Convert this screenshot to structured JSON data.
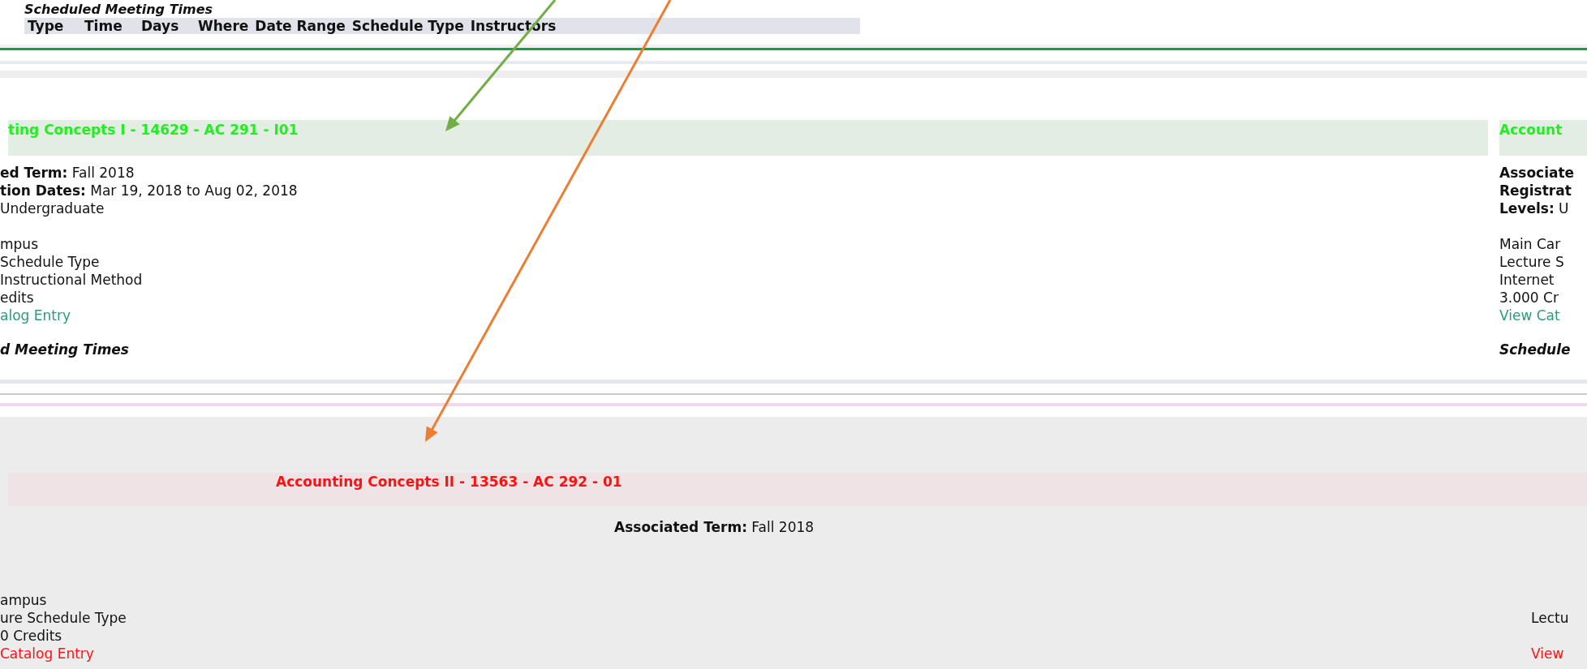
{
  "top_section": {
    "heading": "Scheduled Meeting Times",
    "columns": [
      "Type",
      "Time",
      "Days",
      "Where",
      "Date Range",
      "Schedule Type",
      "Instructors"
    ]
  },
  "upper_panels": [
    {
      "title": "ting Concepts I - 14629 - AC 291 - I01",
      "color": "#22ee22",
      "fields": [
        {
          "label": "ed Term:",
          "value": " Fall 2018"
        },
        {
          "label": "tion Dates:",
          "value": " Mar 19, 2018 to Aug 02, 2018"
        },
        {
          "value": "Undergraduate"
        }
      ],
      "lines": [
        "mpus",
        "Schedule Type",
        "Instructional Method",
        "edits"
      ],
      "link": "alog Entry",
      "subheading": "d Meeting Times"
    },
    {
      "title": "Account",
      "color": "#22ee22",
      "fields": [
        {
          "label": "Associate"
        },
        {
          "label": "Registrat"
        },
        {
          "label": "Levels:",
          "value": " U"
        }
      ],
      "lines": [
        "Main Car",
        "Lecture S",
        "Internet",
        "3.000 Cr"
      ],
      "link": "View Cat",
      "subheading": "Schedule"
    }
  ],
  "lower_panel": {
    "title": "Accounting Concepts II - 13563 - AC 292 - 01",
    "color": "#ff1111",
    "term_label": "Associated Term:",
    "term_value": " Fall 2018",
    "left_lines": [
      "ampus",
      "ure Schedule Type",
      "0 Credits"
    ],
    "left_link": "Catalog Entry",
    "right_lines": [
      "Lectu"
    ],
    "right_link": "View"
  }
}
